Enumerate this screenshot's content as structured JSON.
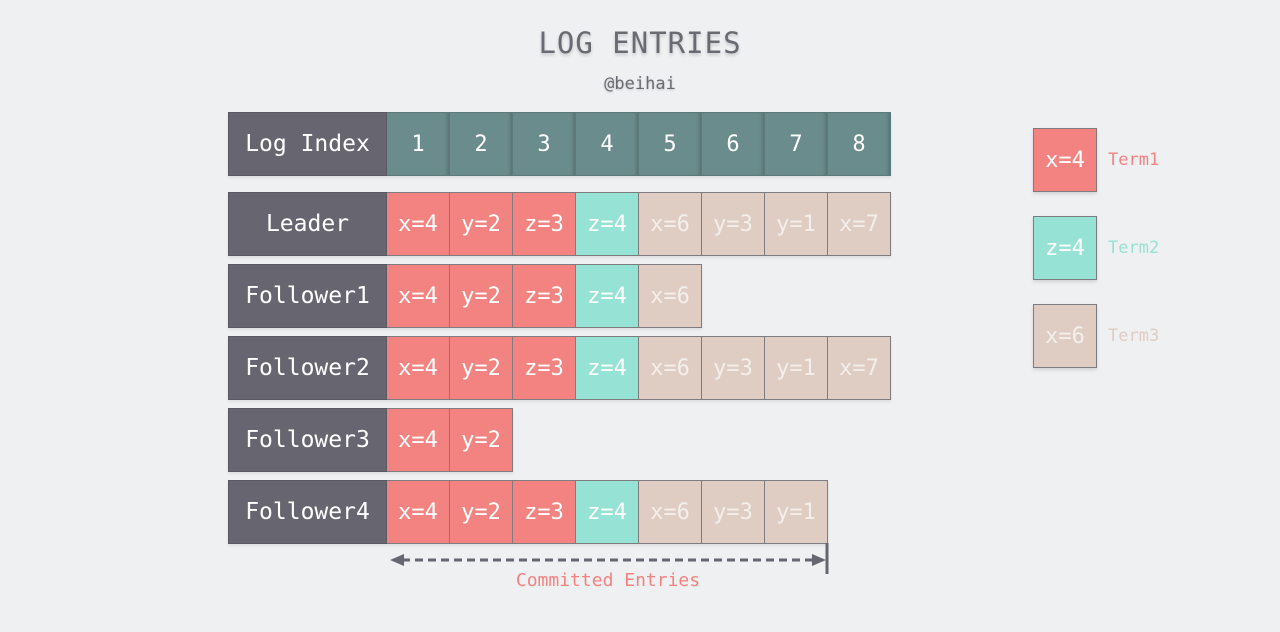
{
  "title": "LOG ENTRIES",
  "subtitle": "@beihai",
  "index_row": {
    "label": "Log Index",
    "indices": [
      "1",
      "2",
      "3",
      "4",
      "5",
      "6",
      "7",
      "8"
    ]
  },
  "servers": [
    {
      "name": "Leader",
      "entries": [
        {
          "text": "x=4",
          "term": 1
        },
        {
          "text": "y=2",
          "term": 1
        },
        {
          "text": "z=3",
          "term": 1
        },
        {
          "text": "z=4",
          "term": 2
        },
        {
          "text": "x=6",
          "term": 3
        },
        {
          "text": "y=3",
          "term": 3
        },
        {
          "text": "y=1",
          "term": 3
        },
        {
          "text": "x=7",
          "term": 3
        }
      ]
    },
    {
      "name": "Follower1",
      "entries": [
        {
          "text": "x=4",
          "term": 1
        },
        {
          "text": "y=2",
          "term": 1
        },
        {
          "text": "z=3",
          "term": 1
        },
        {
          "text": "z=4",
          "term": 2
        },
        {
          "text": "x=6",
          "term": 3
        }
      ]
    },
    {
      "name": "Follower2",
      "entries": [
        {
          "text": "x=4",
          "term": 1
        },
        {
          "text": "y=2",
          "term": 1
        },
        {
          "text": "z=3",
          "term": 1
        },
        {
          "text": "z=4",
          "term": 2
        },
        {
          "text": "x=6",
          "term": 3
        },
        {
          "text": "y=3",
          "term": 3
        },
        {
          "text": "y=1",
          "term": 3
        },
        {
          "text": "x=7",
          "term": 3
        }
      ]
    },
    {
      "name": "Follower3",
      "entries": [
        {
          "text": "x=4",
          "term": 1
        },
        {
          "text": "y=2",
          "term": 1
        }
      ]
    },
    {
      "name": "Follower4",
      "entries": [
        {
          "text": "x=4",
          "term": 1
        },
        {
          "text": "y=2",
          "term": 1
        },
        {
          "text": "z=3",
          "term": 1
        },
        {
          "text": "z=4",
          "term": 2
        },
        {
          "text": "x=6",
          "term": 3
        },
        {
          "text": "y=3",
          "term": 3
        },
        {
          "text": "y=1",
          "term": 3
        }
      ]
    }
  ],
  "legend": [
    {
      "sample": "x=4",
      "label": "Term1",
      "color": "#f28380"
    },
    {
      "sample": "z=4",
      "label": "Term2",
      "color": "#96e2d4"
    },
    {
      "sample": "x=6",
      "label": "Term3",
      "color": "#dfccc2"
    }
  ],
  "committed": {
    "label": "Committed Entries",
    "last_committed_index": 7
  },
  "colors": {
    "background": "#eff0f2",
    "label_bg": "#67656f",
    "index_bg": "#6b8c8c",
    "term1": "#f28380",
    "term2": "#96e2d4",
    "term3": "#dfccc2"
  }
}
